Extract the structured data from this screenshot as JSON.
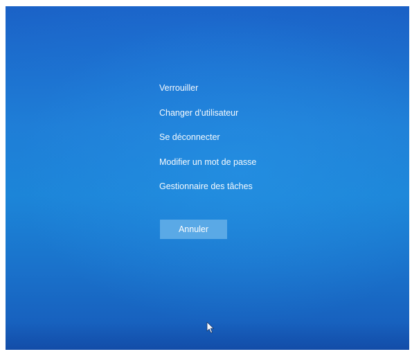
{
  "options_menu": {
    "items": [
      {
        "label": "Verrouiller"
      },
      {
        "label": "Changer d'utilisateur"
      },
      {
        "label": "Se déconnecter"
      },
      {
        "label": "Modifier un mot de passe"
      },
      {
        "label": "Gestionnaire des tâches"
      }
    ]
  },
  "cancel_button": {
    "label": "Annuler"
  },
  "colors": {
    "background": "#1c7ed6",
    "button": "#5aa9e6",
    "text": "#ffffff"
  },
  "icons": {
    "pointer": "mouse-pointer-icon"
  }
}
